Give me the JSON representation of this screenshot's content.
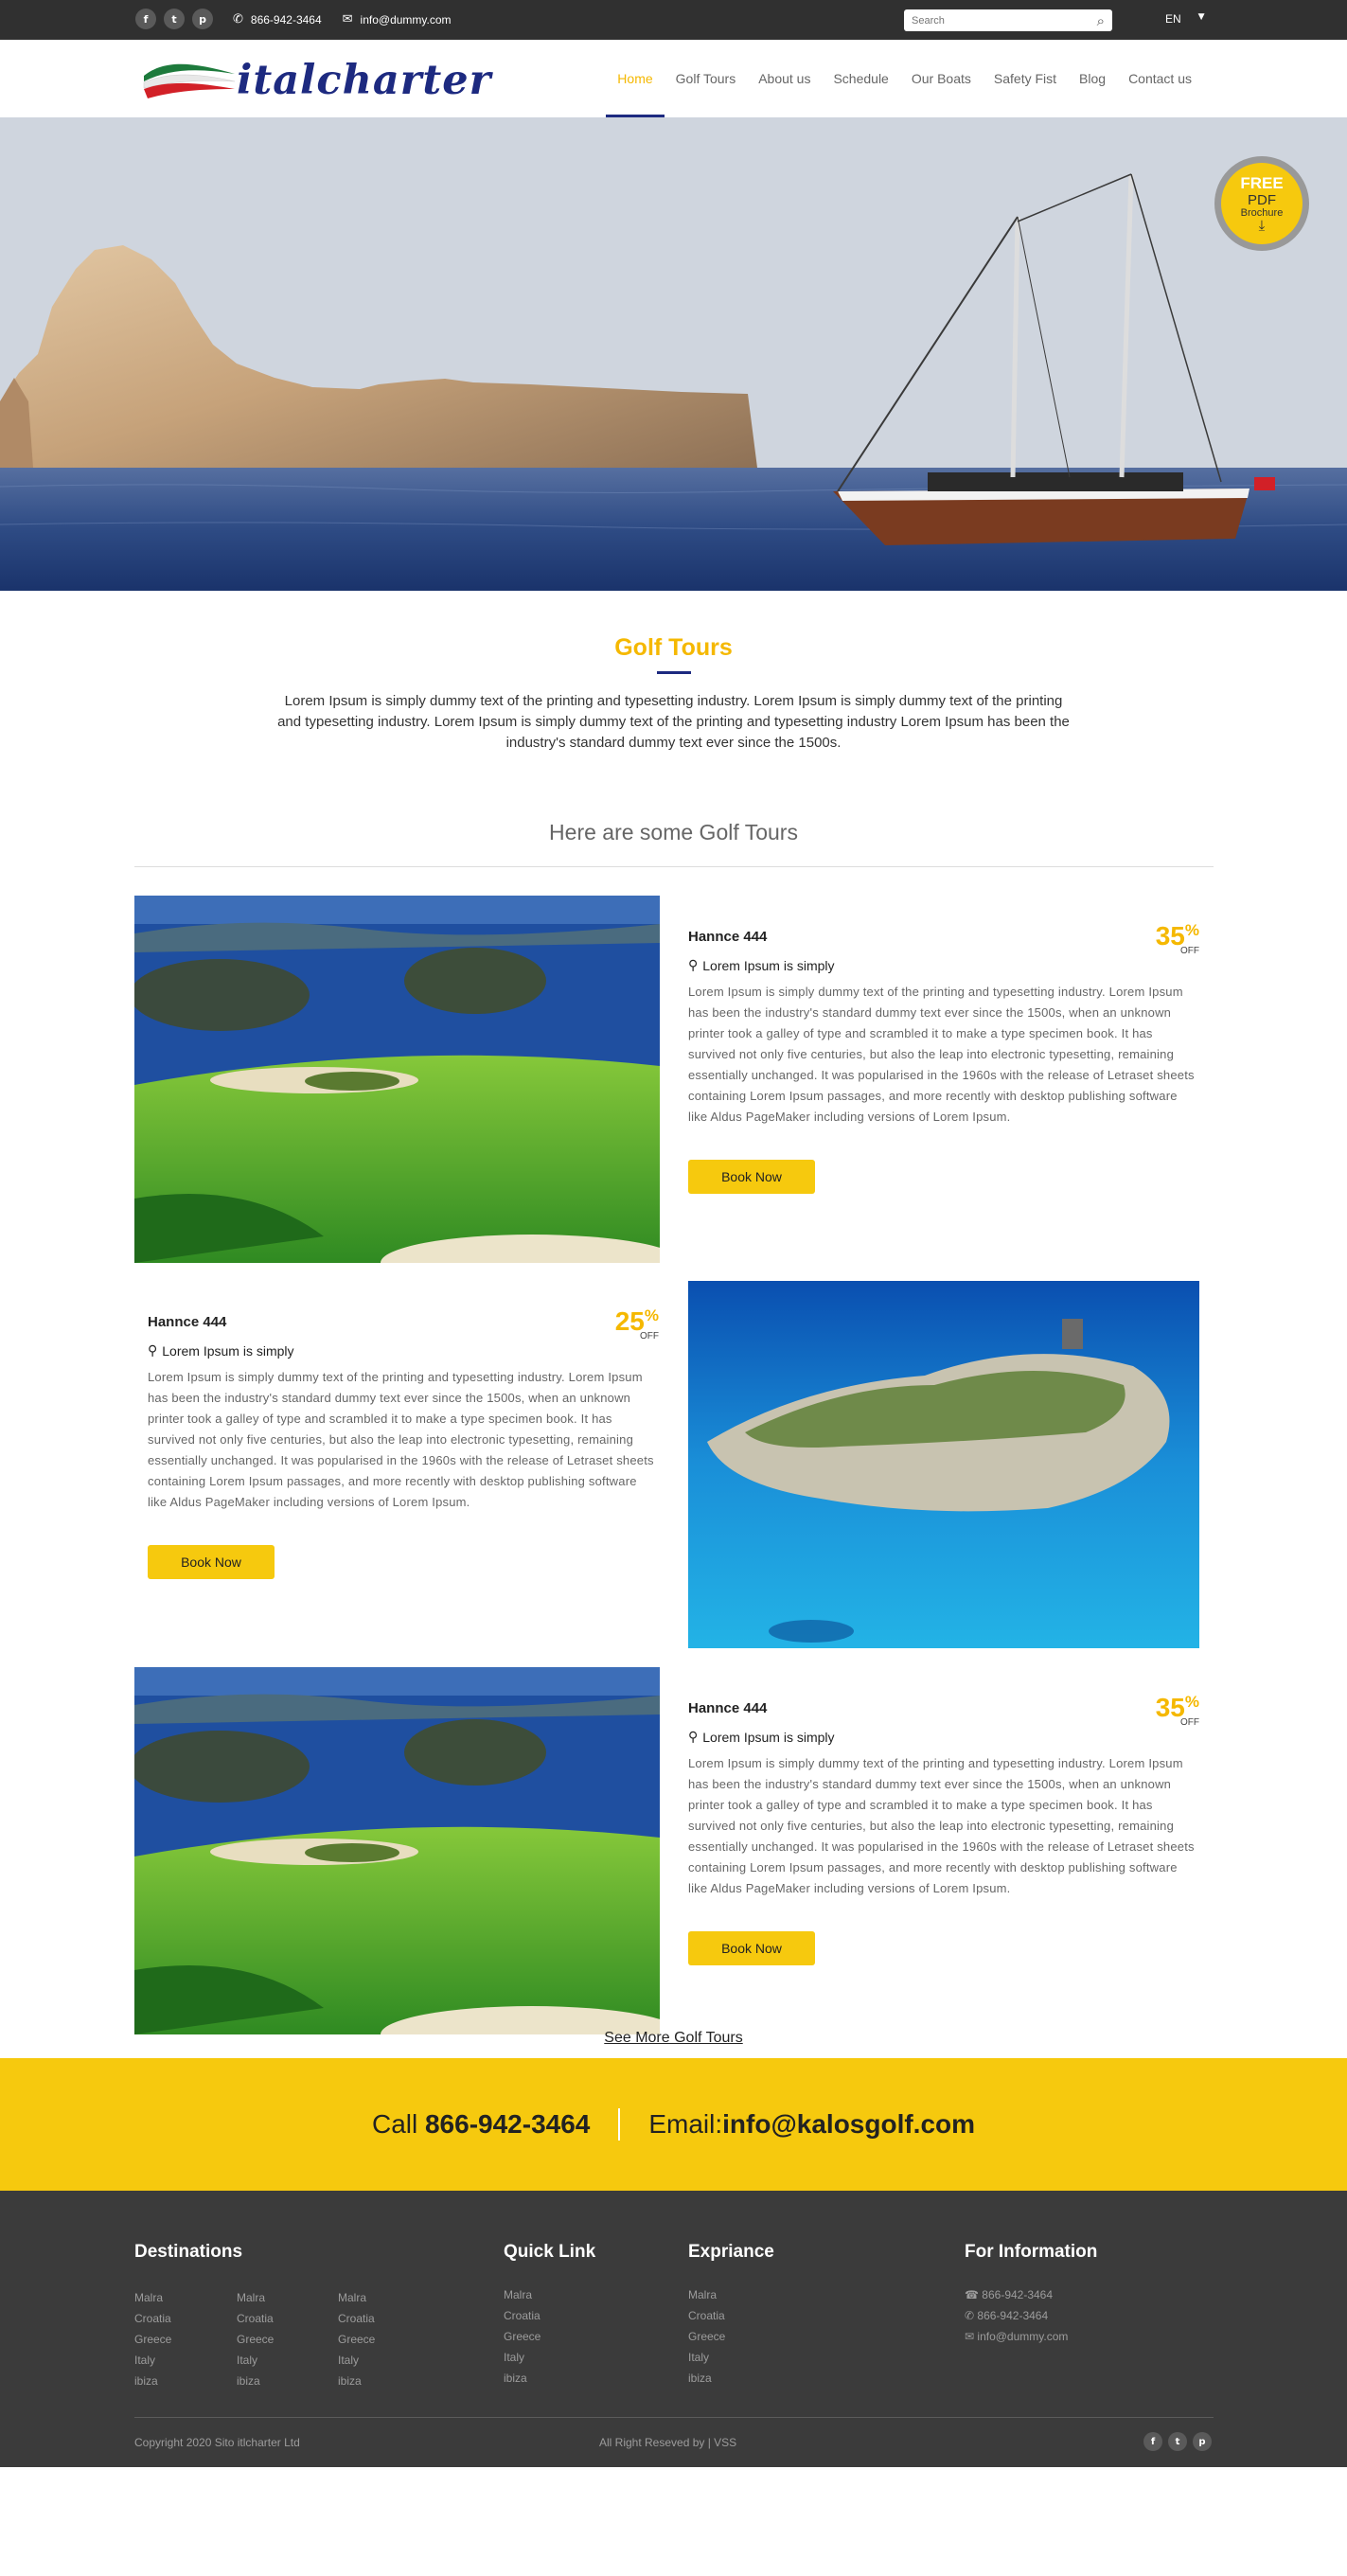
{
  "topbar": {
    "socials": [
      {
        "name": "facebook-icon",
        "glyph": "f"
      },
      {
        "name": "twitter-icon",
        "glyph": "t"
      },
      {
        "name": "pinterest-icon",
        "glyph": "p"
      }
    ],
    "phone_icon": "✆",
    "phone": "866-942-3464",
    "email_icon": "✉",
    "email": "info@dummy.com",
    "search_placeholder": "Search",
    "search_icon": "⌕",
    "language": "EN",
    "language_caret": "▼"
  },
  "nav": {
    "logo_text": "italcharter",
    "items": [
      {
        "label": "Home",
        "active": true
      },
      {
        "label": "Golf Tours",
        "active": false
      },
      {
        "label": "About us",
        "active": false
      },
      {
        "label": "Schedule",
        "active": false
      },
      {
        "label": "Our Boats",
        "active": false
      },
      {
        "label": "Safety Fist",
        "active": false
      },
      {
        "label": "Blog",
        "active": false
      },
      {
        "label": "Contact us",
        "active": false
      }
    ]
  },
  "hero": {
    "brochure": {
      "line1": "FREE",
      "line2": "PDF",
      "line3": "Brochure",
      "icon": "⤓"
    }
  },
  "intro": {
    "title": "Golf Tours",
    "text": "Lorem Ipsum is simply dummy text of the printing and typesetting industry. Lorem Ipsum is simply dummy text of the printing and typesetting industry. Lorem Ipsum is simply dummy text of the printing and typesetting industry Lorem Ipsum has been the industry's standard dummy text ever since the 1500s.",
    "subheading": "Here are some Golf Tours"
  },
  "tours": [
    {
      "name": "Hannce 444",
      "location": "Lorem Ipsum is simply",
      "discount": "35",
      "pct": "%",
      "off": "OFF",
      "description": "Lorem Ipsum is simply dummy text of the printing and typesetting industry. Lorem Ipsum has been the industry's standard dummy text ever since the 1500s, when an unknown printer took a galley of type and scrambled it to make a type specimen book. It has survived not only five centuries, but also the leap into electronic typesetting, remaining essentially unchanged. It was popularised in the 1960s with the release of Letraset sheets containing Lorem Ipsum passages, and more recently with desktop publishing software like Aldus PageMaker including versions of Lorem Ipsum.",
      "button": "Book Now"
    },
    {
      "name": "Hannce 444",
      "location": "Lorem Ipsum is simply",
      "discount": "25",
      "pct": "%",
      "off": "OFF",
      "description": "Lorem Ipsum is simply dummy text of the printing and typesetting industry. Lorem Ipsum has been the industry's standard dummy text ever since the 1500s, when an unknown printer took a galley of type and scrambled it to make a type specimen book. It has survived not only five centuries, but also the leap into electronic typesetting, remaining essentially unchanged. It was popularised in the 1960s with the release of Letraset sheets containing Lorem Ipsum passages, and more recently with desktop publishing software like Aldus PageMaker including versions of Lorem Ipsum.",
      "button": "Book Now"
    },
    {
      "name": "Hannce 444",
      "location": "Lorem Ipsum is simply",
      "discount": "35",
      "pct": "%",
      "off": "OFF",
      "description": "Lorem Ipsum is simply dummy text of the printing and typesetting industry. Lorem Ipsum has been the industry's standard dummy text ever since the 1500s, when an unknown printer took a galley of type and scrambled it to make a type specimen book. It has survived not only five centuries, but also the leap into electronic typesetting, remaining essentially unchanged. It was popularised in the 1960s with the release of Letraset sheets containing Lorem Ipsum passages, and more recently with desktop publishing software like Aldus PageMaker including versions of Lorem Ipsum.",
      "button": "Book Now"
    }
  ],
  "pin_icon": "⚲",
  "see_more": "See More Golf Tours",
  "callband": {
    "call_prefix": "Call ",
    "call_number": "866-942-3464",
    "email_prefix": "Email:",
    "email": "info@kalosgolf.com"
  },
  "footer": {
    "destinations_title": "Destinations",
    "destinations_cols": [
      [
        "Malra",
        "Croatia",
        "Greece",
        "Italy",
        "ibiza"
      ],
      [
        "Malra",
        "Croatia",
        "Greece",
        "Italy",
        "ibiza"
      ],
      [
        "Malra",
        "Croatia",
        "Greece",
        "Italy",
        "ibiza"
      ]
    ],
    "quick_title": "Quick Link",
    "quick_links": [
      "Malra",
      "Croatia",
      "Greece",
      "Italy",
      "ibiza"
    ],
    "exp_title": "Expriance",
    "exp_links": [
      "Malra",
      "Croatia",
      "Greece",
      "Italy",
      "ibiza"
    ],
    "info_title": "For Information",
    "info": [
      {
        "icon": "☎",
        "text": "866-942-3464"
      },
      {
        "icon": "✆",
        "text": "866-942-3464"
      },
      {
        "icon": "✉",
        "text": "info@dummy.com"
      }
    ],
    "copyright": "Copyright 2020 Sito itlcharter Ltd",
    "rights": "All Right Reseved by | VSS",
    "socials": [
      {
        "name": "facebook-icon",
        "glyph": "f"
      },
      {
        "name": "twitter-icon",
        "glyph": "t"
      },
      {
        "name": "pinterest-icon",
        "glyph": "p"
      }
    ]
  },
  "colors": {
    "accent_yellow": "#f6c90e",
    "title_yellow": "#f5b800",
    "brand_navy": "#1d2a80",
    "topbar_dark": "#303030",
    "footer_dark": "#3b3b3b"
  }
}
